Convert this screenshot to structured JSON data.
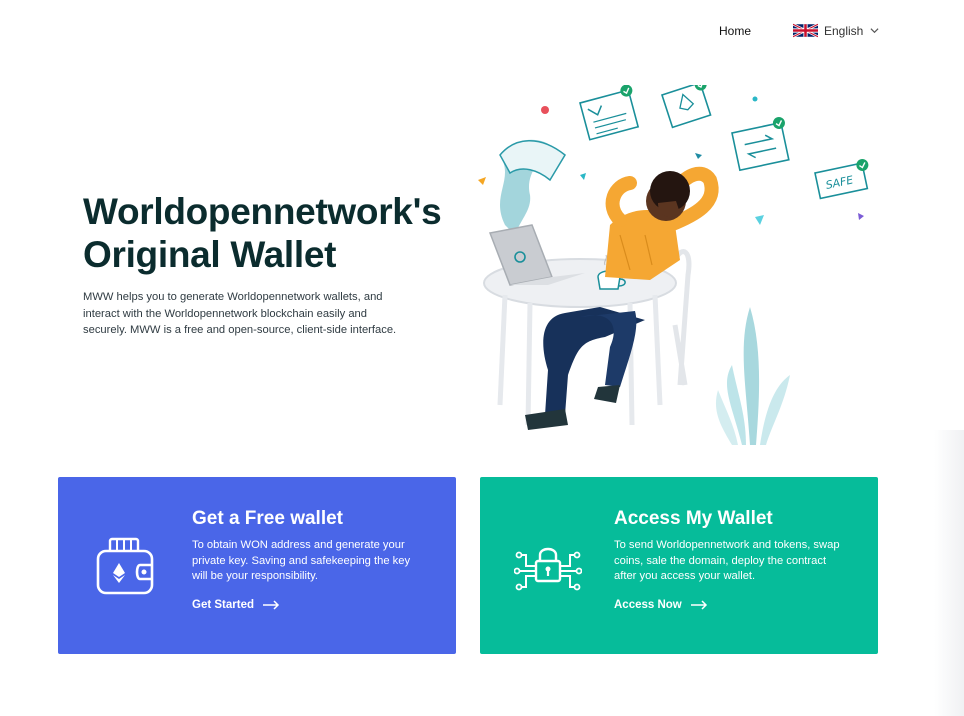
{
  "nav": {
    "home_label": "Home",
    "language_label": "English"
  },
  "hero": {
    "title_line1": "Worldopennetwork's",
    "title_line2": "Original Wallet",
    "description": "MWW helps you to generate Worldopennetwork wallets, and interact with the Worldopennetwork blockchain easily and securely. MWW is a free and open-source, client-side interface.",
    "illustration_badge_text": "SAFE"
  },
  "cards": {
    "free_wallet": {
      "title": "Get a Free wallet",
      "description": "To obtain WON address and generate your private key. Saving and safekeeping the key will be your responsibility.",
      "link_label": "Get Started",
      "color": "#4a66e8"
    },
    "access_wallet": {
      "title": "Access My Wallet",
      "description": "To send Worldopennetwork and tokens, swap coins, sale the domain, deploy the contract after you access your wallet.",
      "link_label": "Access Now",
      "color": "#06bc9a"
    }
  },
  "icons": [
    "uk-flag-icon",
    "chevron-down-icon",
    "wallet-icon",
    "lock-circuit-icon",
    "arrow-right-icon"
  ]
}
